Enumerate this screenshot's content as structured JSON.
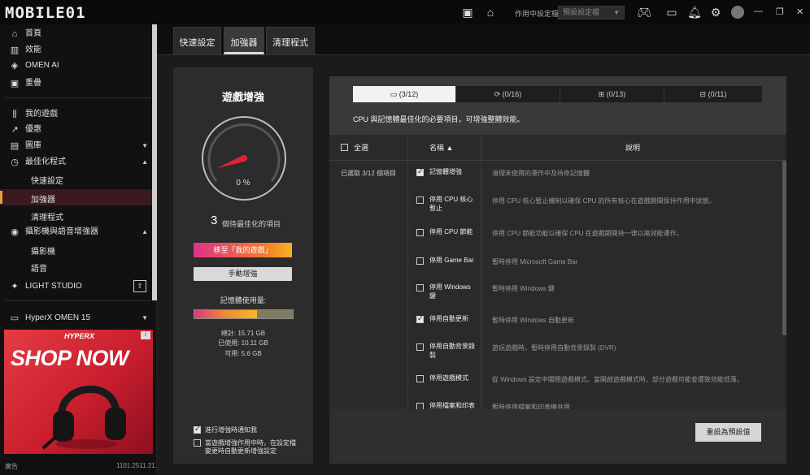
{
  "topbar": {
    "brand": "MOBILE01",
    "config_label": "作用中設定檔",
    "config_value": "預設設定檔"
  },
  "sidebar": {
    "items": [
      {
        "label": "首頁",
        "icon": "home-icon"
      },
      {
        "label": "效能",
        "icon": "performance-icon"
      },
      {
        "label": "OMEN AI",
        "icon": "omen-ai-icon"
      },
      {
        "label": "重疊",
        "icon": "overlay-icon"
      },
      {
        "label": "我的遊戲",
        "icon": "library-icon"
      },
      {
        "label": "優惠",
        "icon": "deals-icon"
      },
      {
        "label": "圖庫",
        "icon": "gallery-icon"
      },
      {
        "label": "最佳化程式",
        "icon": "optimizer-icon"
      },
      {
        "label": "攝影機與語音增強器",
        "icon": "camera-voice-icon"
      },
      {
        "label": "LIGHT STUDIO",
        "icon": "light-studio-icon"
      }
    ],
    "optimizer_sub": [
      "快速設定",
      "加強器",
      "清理程式"
    ],
    "camera_sub": [
      "攝影機",
      "語音"
    ],
    "device": "HyperX OMEN 15",
    "ad": {
      "logo": "HYPERX",
      "headline": "SHOP NOW"
    },
    "footer_left": "廣告",
    "version": "1101.2511.21.0"
  },
  "tabs": [
    "快速設定",
    "加強器",
    "清理程式"
  ],
  "boost": {
    "title": "遊戲增強",
    "gauge_percent": "0 %",
    "gauge_fraction": 0,
    "pending_count": "3",
    "pending_label": "個待最佳化的項目",
    "move_button": "移至「我的遊戲」",
    "manual_button": "手動增強",
    "memory_title": "記憶體使用量:",
    "memory_used_fraction": 0.64,
    "memory_total": "總計: 15.71 GB",
    "memory_used": "已使用: 10.11 GB",
    "memory_free": "可用: 5.6 GB",
    "opt_notify": "進行增強時通知我",
    "opt_notify_checked": true,
    "opt_auto": "當遊戲增強作用中時，在設定檔變更時自動更新增強設定",
    "opt_auto_checked": false
  },
  "categories": [
    {
      "label": "(3/12)",
      "icon": "monitor-icon"
    },
    {
      "label": "(0/16)",
      "icon": "refresh-icon"
    },
    {
      "label": "(0/13)",
      "icon": "apps-icon"
    },
    {
      "label": "(0/11)",
      "icon": "services-icon"
    }
  ],
  "panel": {
    "description": "CPU 與記憶體最佳化的必要項目，可增強整體效能。",
    "select_all": "全選",
    "col_name": "名稱",
    "col_desc": "說明",
    "selected": "已選取 3/12 個項目",
    "reset_button": "重設為預設值"
  },
  "rows": [
    {
      "name": "記憶體增強",
      "desc": "清理未使用的運作中及待命記憶體",
      "checked": true
    },
    {
      "name": "停用 CPU 核心暫止",
      "desc": "停用 CPU 核心暫止機制以確保 CPU 的所有核心在遊戲期間保持作用中狀態。",
      "checked": false
    },
    {
      "name": "停用 CPU 節能",
      "desc": "停用 CPU 節能功能以確保 CPU 在遊戲期間持一律以高效能運作。",
      "checked": false
    },
    {
      "name": "停用 Game Bar",
      "desc": "暫時停用 Microsoft Game Bar",
      "checked": false
    },
    {
      "name": "停用 Windows 鍵",
      "desc": "暫時停用 Windows 鍵",
      "checked": false
    },
    {
      "name": "停用自動更新",
      "desc": "暫時停用 Windows 自動更新",
      "checked": true
    },
    {
      "name": "停用自動背景錄製",
      "desc": "遊玩遊戲時，暫時停用自動背景錄製 (DVR)",
      "checked": false
    },
    {
      "name": "停用遊戲模式",
      "desc": "從 Windows 設定中關閉遊戲模式。當開啟遊戲模式時，部分遊戲可能會遭致效能低落。",
      "checked": false
    },
    {
      "name": "停用檔案和印表",
      "desc": "暫時停用檔案和印表機共用",
      "checked": false
    }
  ]
}
